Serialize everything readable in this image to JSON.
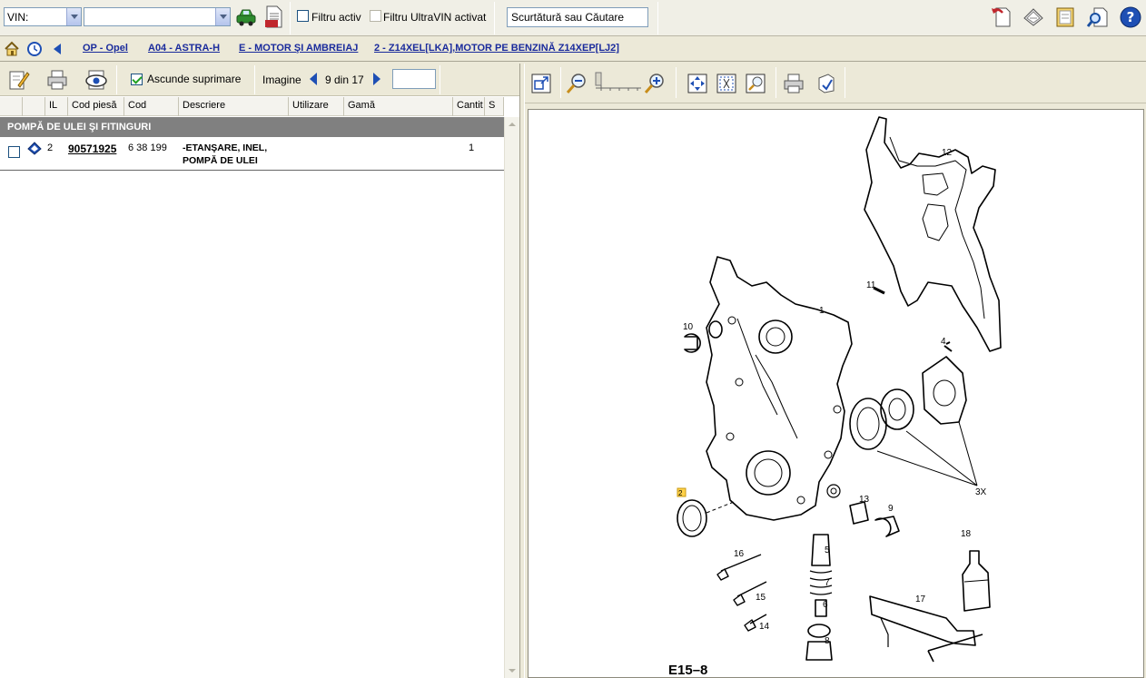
{
  "topbar": {
    "vin_label": "VIN:",
    "vin_value": "",
    "filter_active": "Filtru activ",
    "filter_ultravin": "Filtru UltraVIN activat",
    "search_placeholder": "Scurtătură sau Căutare"
  },
  "breadcrumb": [
    "OP - Opel",
    "A04 - ASTRA-H",
    "E - MOTOR ŞI AMBREIAJ",
    "2 - Z14XEL[LKA],MOTOR PE BENZINĂ Z14XEP[LJ2]"
  ],
  "left_toolbar": {
    "hide_suppression": "Ascunde suprimare",
    "image_label": "Imagine",
    "image_pager": "9 din 17",
    "goto_value": ""
  },
  "table": {
    "headers": [
      "IL",
      "Cod piesă",
      "Cod",
      "Descriere",
      "Utilizare",
      "Gamă",
      "Cantit",
      "S"
    ],
    "group": "POMPĂ DE ULEI ŞI FITINGURI",
    "rows": [
      {
        "il": "2",
        "part_no": "90571925",
        "code": "6 38 199",
        "desc_line1": "-ETANŞARE, INEL,",
        "desc_line2": "POMPĂ DE ULEI",
        "usage": "",
        "range": "",
        "qty": "1",
        "s": ""
      }
    ]
  },
  "drawing": {
    "caption": "E15–8",
    "callouts": [
      "12",
      "11",
      "1",
      "10",
      "4",
      "3X",
      "2",
      "13",
      "9",
      "18",
      "5",
      "16",
      "7",
      "15",
      "6",
      "17",
      "14",
      "8"
    ]
  },
  "colors": {
    "link": "#1a2b9c",
    "group_bg": "#808080",
    "highlight": "#ffd24a"
  }
}
